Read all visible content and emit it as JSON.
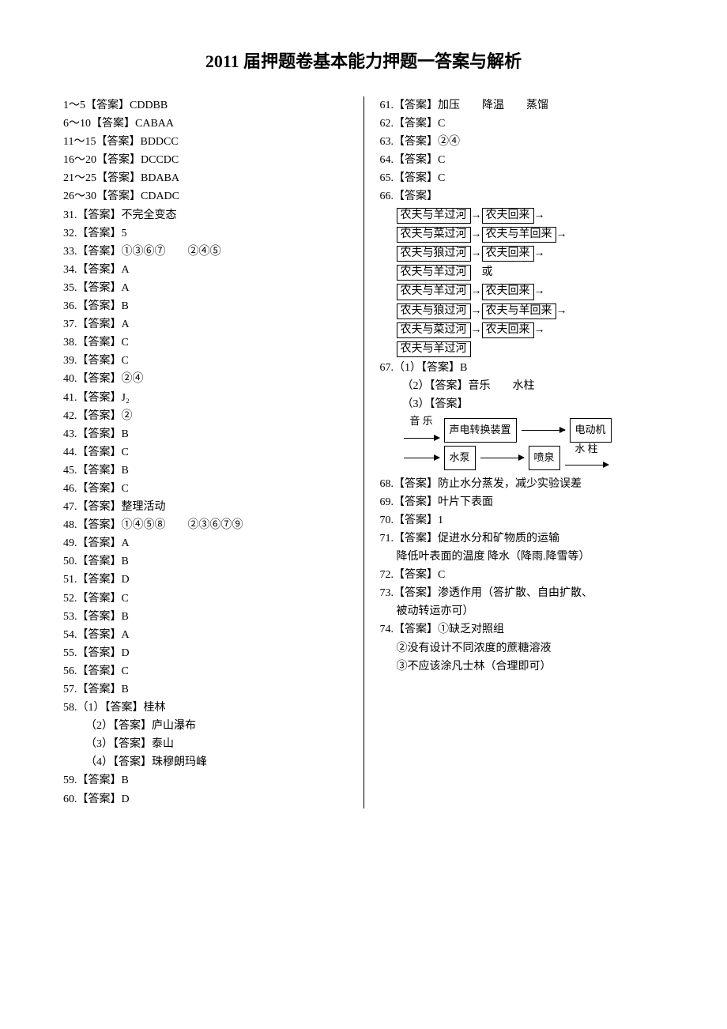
{
  "title": "2011 届押题卷基本能力押题一答案与解析",
  "left": {
    "range": [
      {
        "r": "1～5",
        "a": "CDDBB"
      },
      {
        "r": "6～10",
        "a": "CABAA"
      },
      {
        "r": "11～15",
        "a": "BDDCC"
      },
      {
        "r": "16～20",
        "a": "DCCDC"
      },
      {
        "r": "21～25",
        "a": "BDABA"
      },
      {
        "r": "26～30",
        "a": "CDADC"
      }
    ],
    "q31": "不完全变态",
    "q32": "5",
    "q33": "①③⑥⑦　　②④⑤",
    "q34": "A",
    "q35": "A",
    "q36": "B",
    "q37": "A",
    "q38": "C",
    "q39": "C",
    "q40": "②④",
    "q41": "J₂",
    "q42": "②",
    "q43": "B",
    "q44": "C",
    "q45": "B",
    "q46": "C",
    "q47": "整理活动",
    "q48": "①④⑤⑧　　②③⑥⑦⑨",
    "q49": "A",
    "q50": "B",
    "q51": "D",
    "q52": "C",
    "q53": "B",
    "q54": "A",
    "q55": "D",
    "q56": "C",
    "q57": "B",
    "q58_1": "桂林",
    "q58_2": "庐山瀑布",
    "q58_3": "泰山",
    "q58_4": "珠穆朗玛峰",
    "q59": "B",
    "q60": "D"
  },
  "right": {
    "q61": "加压　　降温　　蒸馏",
    "q62": "C",
    "q63": "②④",
    "q64": "C",
    "q65": "C",
    "q66": {
      "steps_a": [
        "农夫与羊过河",
        "农夫回来",
        "农夫与菜过河",
        "农夫与羊回来",
        "农夫与狼过河",
        "农夫回来",
        "农夫与羊过河"
      ],
      "or": "或",
      "steps_b": [
        "农夫与羊过河",
        "农夫回来",
        "农夫与狼过河",
        "农夫与羊回来",
        "农夫与菜过河",
        "农夫回来",
        "农夫与羊过河"
      ]
    },
    "q67_1": "B",
    "q67_2": "音乐　　水柱",
    "q67_3_label": "",
    "diagram": {
      "music": "音 乐",
      "dev": "声电转换装置",
      "motor": "电动机",
      "pump": "水泵",
      "fount": "喷泉",
      "col": "水 柱"
    },
    "q68": "防止水分蒸发，减少实验误差",
    "q69": "叶片下表面",
    "q70": "1",
    "q71_a": "促进水分和矿物质的运输",
    "q71_b": "降低叶表面的温度   降水（降雨.降雪等）",
    "q72": "C",
    "q73": "渗透作用（答扩散、自由扩散、",
    "q73b": "被动转运亦可）",
    "q74_a": "①缺乏对照组",
    "q74_b": "②没有设计不同浓度的蔗糖溶液",
    "q74_c": "③不应该涂凡士林（合理即可）"
  },
  "labels": {
    "ans": "【答案】"
  }
}
